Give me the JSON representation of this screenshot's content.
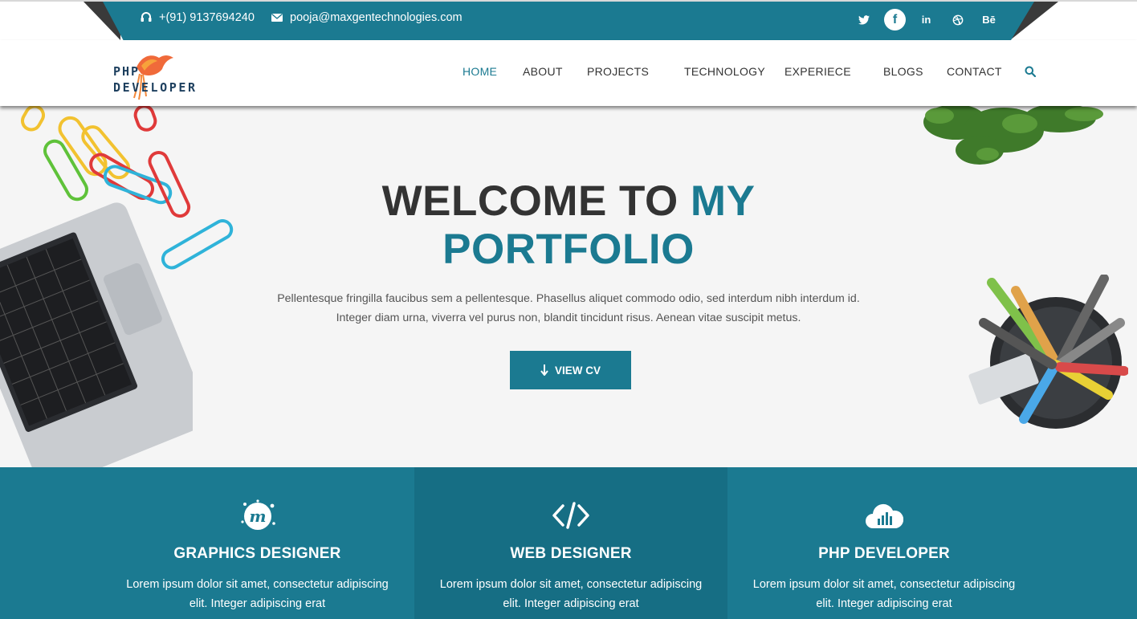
{
  "topbar": {
    "phone": "+(91) 9137694240",
    "email": "pooja@maxgentechnologies.com",
    "socials": [
      {
        "name": "twitter",
        "glyph": ""
      },
      {
        "name": "facebook",
        "glyph": "f"
      },
      {
        "name": "linkedin",
        "glyph": "in"
      },
      {
        "name": "dribbble",
        "glyph": ""
      },
      {
        "name": "behance",
        "glyph": "Bē"
      }
    ]
  },
  "logo": {
    "line1": "PHP",
    "line2": "DEVELOPER"
  },
  "nav": {
    "home": "HOME",
    "about": "ABOUT",
    "projects": "PROJECTS",
    "technology": "TECHNOLOGY",
    "experience": "EXPERIECE",
    "blogs": "BLOGS",
    "contact": "CONTACT"
  },
  "hero": {
    "title_part1": "WELCOME TO ",
    "title_part2": "MY",
    "title_line2": "PORTFOLIO",
    "text_line1": "Pellentesque fringilla faucibus sem a pellentesque. Phasellus aliquet commodo odio, sed interdum nibh interdum id.",
    "text_line2": "Integer diam urna, viverra vel purus non, blandit tincidunt risus. Aenean vitae suscipit metus.",
    "cta": "VIEW CV"
  },
  "services": [
    {
      "icon": "meetup-icon",
      "title": "GRAPHICS DESIGNER",
      "line1": "Lorem ipsum dolor sit amet, consectetur adipiscing",
      "line2": "elit. Integer adipiscing erat"
    },
    {
      "icon": "code-icon",
      "title": "WEB DESIGNER",
      "line1": "Lorem ipsum dolor sit amet, consectetur adipiscing",
      "line2": "elit. Integer adipiscing erat"
    },
    {
      "icon": "cloud-chart-icon",
      "title": "PHP DEVELOPER",
      "line1": "Lorem ipsum dolor sit amet, consectetur adipiscing",
      "line2": "elit. Integer adipiscing erat"
    }
  ],
  "colors": {
    "accent": "#1b7a91",
    "dark": "#3a3a3a",
    "hero_bg": "#f5f5f5"
  }
}
